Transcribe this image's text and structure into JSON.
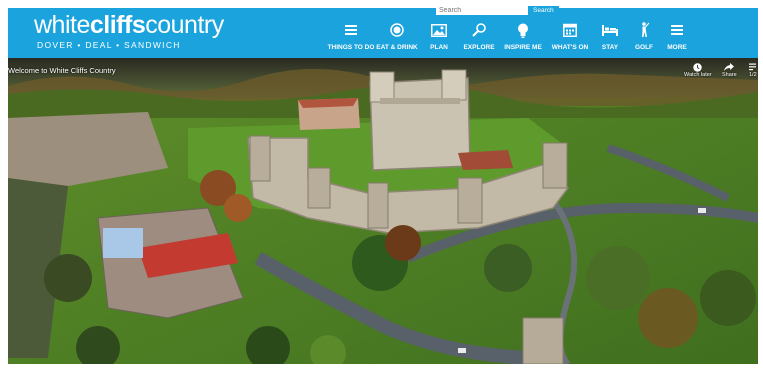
{
  "brand": {
    "name_part1": "white",
    "name_part2": "cliffs",
    "name_part3": "country",
    "tagline": "DOVER • DEAL • SANDWICH"
  },
  "search": {
    "placeholder": "Search",
    "button_label": "Search"
  },
  "nav": {
    "items": [
      {
        "label": "THINGS TO DO",
        "icon": "menu-lines-icon"
      },
      {
        "label": "EAT & DRINK",
        "icon": "plate-icon"
      },
      {
        "label": "PLAN",
        "icon": "map-icon"
      },
      {
        "label": "EXPLORE",
        "icon": "magnifier-icon"
      },
      {
        "label": "INSPIRE ME",
        "icon": "lightbulb-icon"
      },
      {
        "label": "WHAT'S ON",
        "icon": "calendar-icon"
      },
      {
        "label": "STAY",
        "icon": "bed-icon"
      },
      {
        "label": "GOLF",
        "icon": "golfer-icon"
      },
      {
        "label": "MORE",
        "icon": "more-lines-icon"
      }
    ]
  },
  "video": {
    "title": "Welcome to White Cliffs Country",
    "watch_later": "Watch later",
    "share": "Share",
    "playlist_count": "1/2"
  },
  "colors": {
    "header_bg": "#1aa3dc",
    "text": "#ffffff"
  }
}
